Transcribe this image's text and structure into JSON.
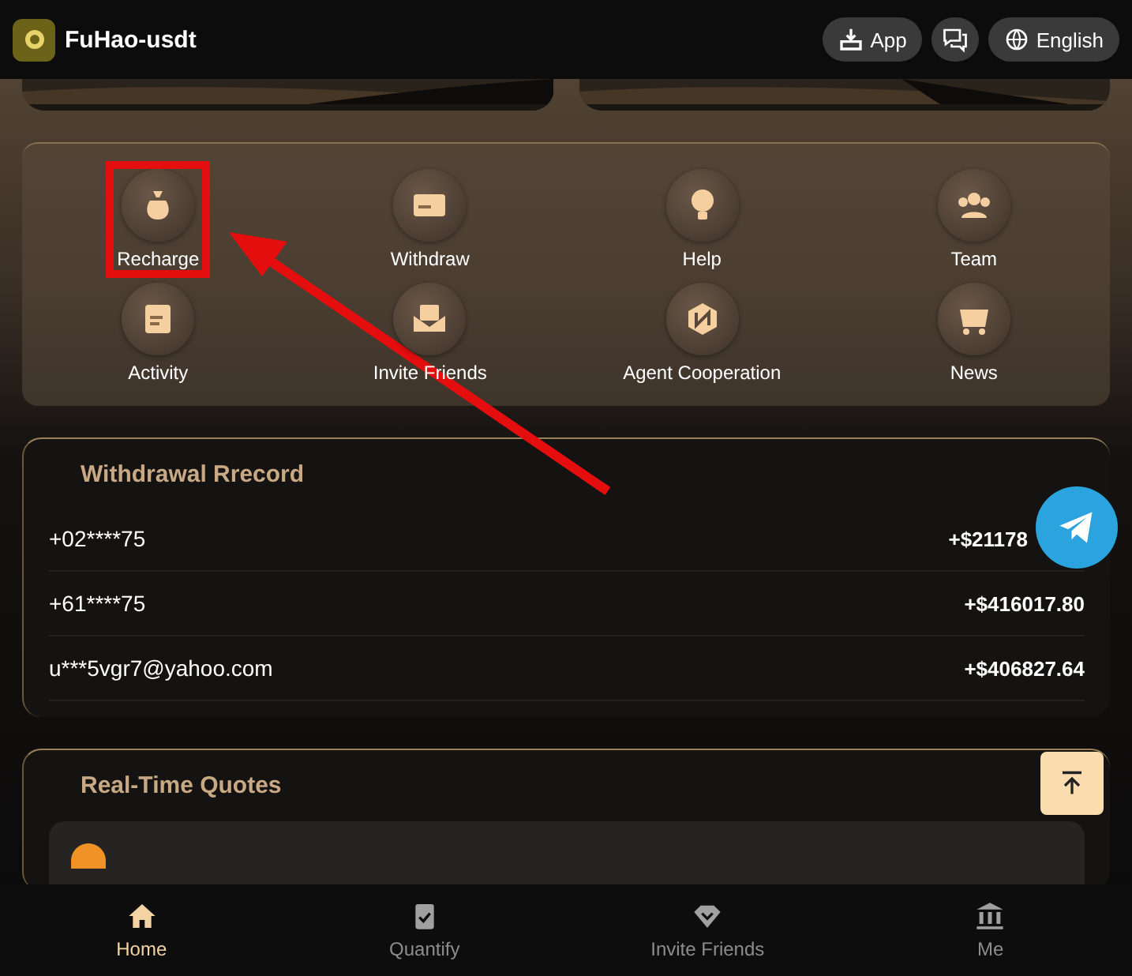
{
  "header": {
    "brand": "FuHao-usdt",
    "app_button": "App",
    "language": "English"
  },
  "menu": [
    {
      "label": "Recharge",
      "highlighted": true
    },
    {
      "label": "Withdraw",
      "highlighted": false
    },
    {
      "label": "Help",
      "highlighted": false
    },
    {
      "label": "Team",
      "highlighted": false
    },
    {
      "label": "Activity",
      "highlighted": false
    },
    {
      "label": "Invite Friends",
      "highlighted": false
    },
    {
      "label": "Agent Cooperation",
      "highlighted": false
    },
    {
      "label": "News",
      "highlighted": false
    }
  ],
  "withdrawals": {
    "title": "Withdrawal Rrecord",
    "rows": [
      {
        "account": "+02****75",
        "amount": "+$21178"
      },
      {
        "account": "+61****75",
        "amount": "+$416017.80"
      },
      {
        "account": "u***5vgr7@yahoo.com",
        "amount": "+$406827.64"
      }
    ]
  },
  "quotes": {
    "title": "Real-Time Quotes"
  },
  "nav": [
    {
      "label": "Home",
      "selected": true
    },
    {
      "label": "Quantify",
      "selected": false
    },
    {
      "label": "Invite Friends",
      "selected": false
    },
    {
      "label": "Me",
      "selected": false
    }
  ]
}
